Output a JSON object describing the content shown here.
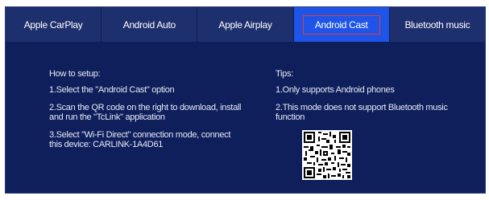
{
  "tabs": [
    {
      "label": "Apple CarPlay",
      "active": false
    },
    {
      "label": "Android Auto",
      "active": false
    },
    {
      "label": "Apple Airplay",
      "active": false
    },
    {
      "label": "Android Cast",
      "active": true
    },
    {
      "label": "Bluetooth music",
      "active": false
    }
  ],
  "setup": {
    "heading": "How to setup:",
    "step1": "1.Select the \"Android Cast\" option",
    "step2": "2.Scan the QR code on the right to download, install and run the \"TcLink\" application",
    "step3": "3.Select \"Wi-Fi Direct\" connection mode, connect this device: CARLINK-1A4D61"
  },
  "tips": {
    "heading": "Tips:",
    "tip1": "1.Only supports Android phones",
    "tip2": "2.This mode does not support Bluetooth music function"
  },
  "colors": {
    "background": "#0e1f5c",
    "tab_bar": "#1e2f6d",
    "active_tab": "#1e55e8",
    "highlight_border": "#e23b3b"
  },
  "icons": {
    "qr": "qr-code-icon"
  }
}
